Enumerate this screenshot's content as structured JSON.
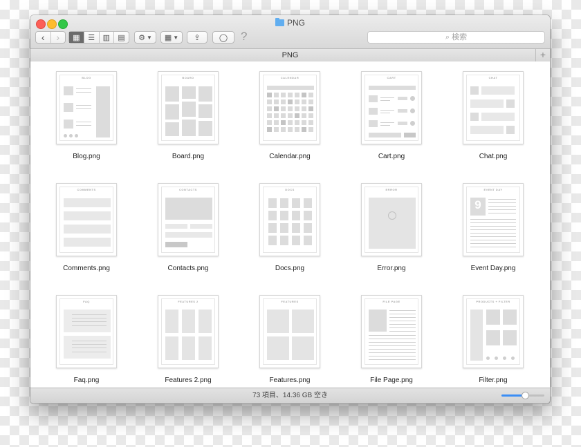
{
  "window": {
    "title": "PNG",
    "folder_icon": "folder-icon"
  },
  "toolbar": {
    "back": "‹",
    "forward": "›",
    "view_icons": "▦",
    "view_list": "☰",
    "view_columns": "▥",
    "view_coverflow": "▤",
    "action": "⚙",
    "arrange": "▦",
    "share": "⇪",
    "tag": "◯",
    "help": "?",
    "search_placeholder": "⌕ 検索"
  },
  "pathbar": {
    "title": "PNG",
    "add": "+"
  },
  "files": [
    {
      "name": "Blog.png",
      "thumb_title": "BLOG"
    },
    {
      "name": "Board.png",
      "thumb_title": "BOARD"
    },
    {
      "name": "Calendar.png",
      "thumb_title": "CALENDAR"
    },
    {
      "name": "Cart.png",
      "thumb_title": "CART"
    },
    {
      "name": "Chat.png",
      "thumb_title": "CHAT"
    },
    {
      "name": "Comments.png",
      "thumb_title": "COMMENTS"
    },
    {
      "name": "Contacts.png",
      "thumb_title": "CONTACTS"
    },
    {
      "name": "Docs.png",
      "thumb_title": "DOCS"
    },
    {
      "name": "Error.png",
      "thumb_title": "ERROR"
    },
    {
      "name": "Event Day.png",
      "thumb_title": "EVENT DAY",
      "number": "9"
    },
    {
      "name": "Faq.png",
      "thumb_title": "FAQ"
    },
    {
      "name": "Features 2.png",
      "thumb_title": "FEATURES 2"
    },
    {
      "name": "Features.png",
      "thumb_title": "FEATURES"
    },
    {
      "name": "File Page.png",
      "thumb_title": "FILE PAGE"
    },
    {
      "name": "Filter.png",
      "thumb_title": "PRODUCTS + FILTER"
    }
  ],
  "status": {
    "text": "73 項目、14.36 GB 空き",
    "zoom_level": 0.55
  },
  "colors": {
    "accent": "#3b8ef5",
    "close": "#fc5f57",
    "minimize": "#fdbc2e",
    "zoom": "#33c748"
  }
}
